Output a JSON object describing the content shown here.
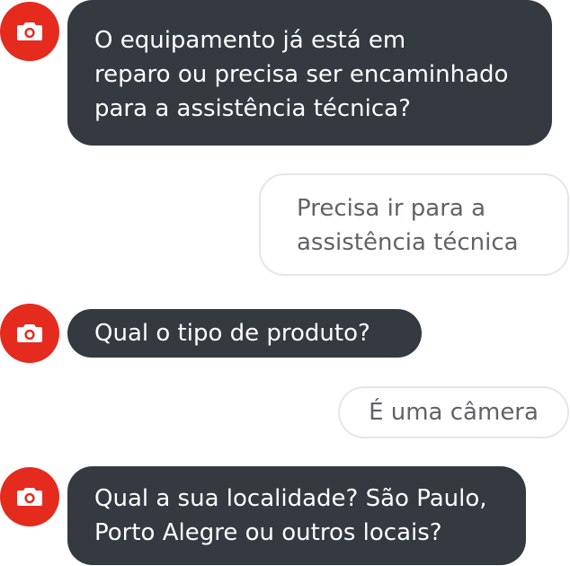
{
  "chat": {
    "bot_avatar_icon": "camera-icon",
    "accent_color": "#e52a1e",
    "bot_bubble_color": "#343a40",
    "messages": [
      {
        "sender": "bot",
        "text": "O equipamento já está em\nreparo ou precisa ser encaminhado\npara a assistência técnica?"
      },
      {
        "sender": "user",
        "text": "Precisa ir para a\nassistência técnica"
      },
      {
        "sender": "bot",
        "text": "Qual o tipo de produto?"
      },
      {
        "sender": "user",
        "text": "É uma câmera"
      },
      {
        "sender": "bot",
        "text": "Qual a sua localidade? São Paulo,\nPorto Alegre ou outros locais?"
      }
    ]
  }
}
